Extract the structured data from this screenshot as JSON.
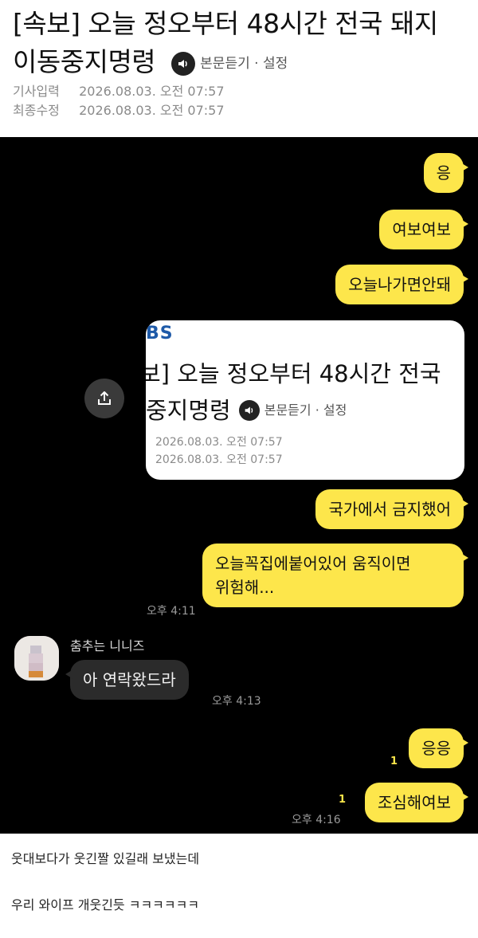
{
  "article": {
    "headline_line1": "[속보] 오늘 정오부터 48시간 전국 돼지",
    "headline_line2": "이동중지명령",
    "tools_label": "본문듣기 · 설정",
    "meta": [
      {
        "label": "기사입력",
        "value": "2026.08.03. 오전 07:57"
      },
      {
        "label": "최종수정",
        "value": "2026.08.03. 오전 07:57"
      }
    ]
  },
  "chat": {
    "messages_out_1": [
      "응",
      "여보여보",
      "오늘나가면안돼"
    ],
    "card": {
      "logo": "BS",
      "headline_line1": "보] 오늘 정오부터 48시간 전국",
      "headline_line2": "중지명령",
      "tools_label": "본문듣기 · 설정",
      "meta": [
        "2026.08.03. 오전 07:57",
        "2026.08.03. 오전 07:57"
      ]
    },
    "messages_out_2": [
      "국가에서 금지했어",
      "오늘꼭집에붙어있어 움직이면",
      "위험해..."
    ],
    "time_out_2": "오후 4:11",
    "sender_name": "춤추는 니니즈",
    "message_in": "아 연락왔드라",
    "time_in": "오후 4:13",
    "messages_out_3": [
      "응응",
      "조심해여보"
    ],
    "unread_1": "1",
    "unread_2": "1",
    "time_out_3": "오후 4:16"
  },
  "caption": {
    "line1": "웃대보다가 웃긴짤 있길래 보냈는데",
    "line2": "우리 와이프 개웃긴듯 ㅋㅋㅋㅋㅋㅋ"
  },
  "colors": {
    "bubble_out": "#fde64b",
    "bubble_in": "#2b2b2b",
    "chat_bg": "#000000"
  }
}
